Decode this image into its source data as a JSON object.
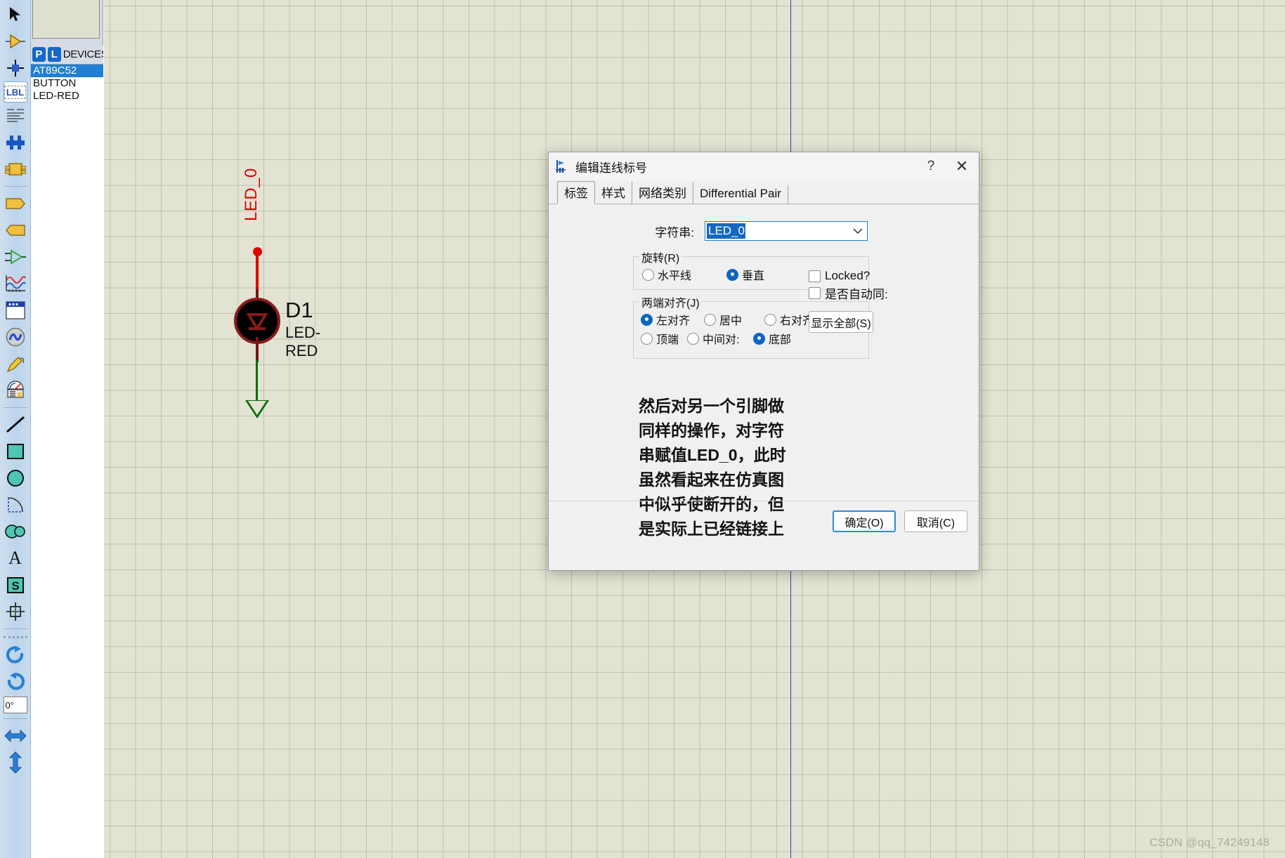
{
  "toolbar": {
    "items": [
      {
        "name": "selection-mode-icon",
        "label": "Selection Mode"
      },
      {
        "name": "component-mode-icon",
        "label": "Component Mode"
      },
      {
        "name": "junction-dot-icon",
        "label": "Junction Dot Mode"
      },
      {
        "name": "wire-label-icon",
        "label": "LBL",
        "selected": true
      },
      {
        "name": "text-script-icon",
        "label": "Text Script Mode"
      },
      {
        "name": "bus-icon",
        "label": "Buses Mode"
      },
      {
        "name": "subcircuit-icon",
        "label": "Subcircuit Mode"
      },
      {
        "name": "terminal-left-icon",
        "label": "Terminals Mode"
      },
      {
        "name": "terminal-right-icon",
        "label": "Terminals Mode 2"
      },
      {
        "name": "device-pin-icon",
        "label": "Device Pins Mode"
      },
      {
        "name": "graph-icon",
        "label": "Graph Mode"
      },
      {
        "name": "tape-recorder-icon",
        "label": "Tape Recorder"
      },
      {
        "name": "generator-icon",
        "label": "Generator Mode"
      },
      {
        "name": "voltage-probe-icon",
        "label": "Voltage Probe Mode"
      },
      {
        "name": "virtual-instrument-icon",
        "label": "Virtual Instruments Mode"
      },
      {
        "name": "line-tool-icon",
        "label": "2D Line"
      },
      {
        "name": "box-tool-icon",
        "label": "2D Box"
      },
      {
        "name": "circle-tool-icon",
        "label": "2D Circle"
      },
      {
        "name": "arc-tool-icon",
        "label": "2D Arc"
      },
      {
        "name": "path-tool-icon",
        "label": "2D Path"
      },
      {
        "name": "text-tool-icon",
        "label": "2D Text"
      },
      {
        "name": "symbol-tool-icon",
        "label": "2D Symbol"
      },
      {
        "name": "marker-tool-icon",
        "label": "2D Markers"
      },
      {
        "name": "rotate-cw-icon",
        "label": "Rotate Clockwise"
      },
      {
        "name": "rotate-ccw-icon",
        "label": "Rotate Anticlockwise"
      }
    ],
    "rotation_value": "0°",
    "mirror_horizontal": "mirror-horizontal-icon",
    "mirror_vertical": "mirror-vertical-icon"
  },
  "left_panel": {
    "p_button": "P",
    "l_button": "L",
    "devices_label": "DEVICES",
    "devices": [
      {
        "name": "AT89C52",
        "selected": true
      },
      {
        "name": "BUTTON",
        "selected": false
      },
      {
        "name": "LED-RED",
        "selected": false
      }
    ]
  },
  "canvas": {
    "net_label": "LED_0",
    "component_ref": "D1",
    "component_value": "LED-RED",
    "watermark": "CSDN @qq_74249148"
  },
  "dialog": {
    "title": "编辑连线标号",
    "help_button": "?",
    "close_button": "✕",
    "tabs": [
      {
        "label": "标签",
        "active": true
      },
      {
        "label": "样式",
        "active": false
      },
      {
        "label": "网络类别",
        "active": false
      },
      {
        "label": "Differential Pair",
        "active": false
      }
    ],
    "string_label": "字符串:",
    "string_value": "LED_0",
    "rotation": {
      "title": "旋转(R)",
      "options": [
        {
          "label": "水平线",
          "selected": false
        },
        {
          "label": "垂直",
          "selected": true
        }
      ]
    },
    "justify": {
      "title": "两端对齐(J)",
      "options": [
        {
          "label": "左对齐",
          "selected": true
        },
        {
          "label": "居中",
          "selected": false
        },
        {
          "label": "右对齐",
          "selected": false
        },
        {
          "label": "顶端",
          "selected": false
        },
        {
          "label": "中间对:",
          "selected": false
        },
        {
          "label": "底部",
          "selected": true
        }
      ]
    },
    "checkboxes": [
      {
        "label": "Locked?",
        "checked": false
      },
      {
        "label": "是否自动同:",
        "checked": false
      }
    ],
    "show_all_button": "显示全部(S)",
    "annotation": "然后对另一个引脚做同样的操作，对字符串赋值LED_0，此时虽然看起来在仿真图中似乎使断开的，但是实际上已经链接上",
    "ok_button": "确定(O)",
    "cancel_button": "取消(C)"
  }
}
